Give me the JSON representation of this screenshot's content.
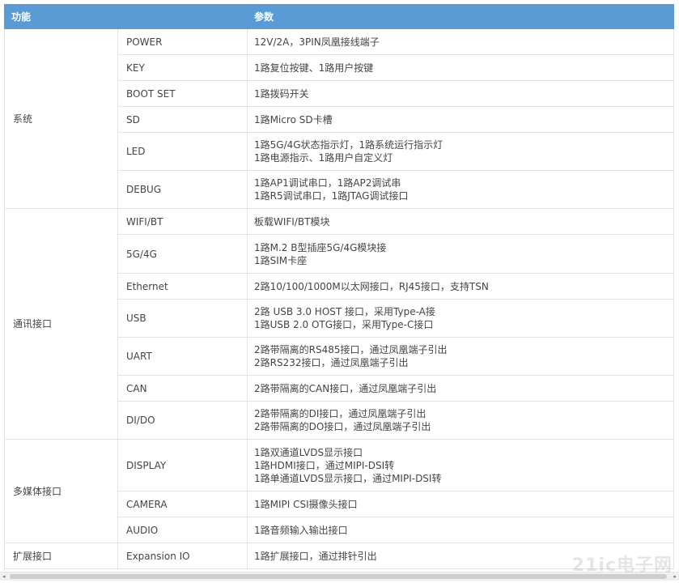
{
  "header": {
    "col_function": "功能",
    "col_params": "参数"
  },
  "groups": [
    {
      "name": "系统",
      "rows": [
        {
          "func": "POWER",
          "lines": [
            "12V/2A，3PIN凤凰接线端子"
          ],
          "h": 32
        },
        {
          "func": "KEY",
          "lines": [
            "1路复位按键、1路用户按键"
          ],
          "h": 32
        },
        {
          "func": "BOOT SET",
          "lines": [
            "1路拨码开关"
          ],
          "h": 32
        },
        {
          "func": "SD",
          "lines": [
            "1路Micro SD卡槽"
          ],
          "h": 32
        },
        {
          "func": "LED",
          "lines": [
            "1路5G/4G状态指示灯，1路系统运行指示灯",
            "1路电源指示、1路用户自定义灯"
          ],
          "h": 47
        },
        {
          "func": "DEBUG",
          "lines": [
            "1路AP1调试串口，1路AP2调试串",
            "1路R5调试串口，1路JTAG调试接口"
          ],
          "h": 47
        }
      ]
    },
    {
      "name": "通讯接口",
      "rows": [
        {
          "func": "WIFI/BT",
          "lines": [
            "板载WIFI/BT模块"
          ],
          "h": 32
        },
        {
          "func": "5G/4G",
          "lines": [
            "1路M.2 B型插座5G/4G模块接",
            "1路SIM卡座"
          ],
          "h": 48
        },
        {
          "func": "Ethernet",
          "lines": [
            "2路10/100/1000M以太网接口，RJ45接口，支持TSN"
          ],
          "h": 32
        },
        {
          "func": "USB",
          "lines": [
            "2路 USB 3.0 HOST 接口，采用Type-A接",
            "1路USB 2.0 OTG接口，采用Type-C接口"
          ],
          "h": 47
        },
        {
          "func": "UART",
          "lines": [
            "2路带隔离的RS485接口，通过凤凰端子引出",
            "2路RS232接口，通过凤凰端子引出"
          ],
          "h": 47
        },
        {
          "func": "CAN",
          "lines": [
            "2路带隔离的CAN接口，通过凤凰端子引出"
          ],
          "h": 32
        },
        {
          "func": "DI/DO",
          "lines": [
            "2路带隔离的DI接口，通过凤凰端子引出",
            "2路带隔离的DO接口，通过凤凰端子引出"
          ],
          "h": 47
        }
      ]
    },
    {
      "name": "多媒体接口",
      "rows": [
        {
          "func": "DISPLAY",
          "lines": [
            "1路双通道LVDS显示接口",
            "1路HDMI接口，通过MIPI-DSI转",
            "1路单通道LVDS显示接口，通过MIPI-DSI转"
          ],
          "h": 64
        },
        {
          "func": "CAMERA",
          "lines": [
            "1路MIPI CSI摄像头接口"
          ],
          "h": 32
        },
        {
          "func": "AUDIO",
          "lines": [
            "1路音频输入输出接口"
          ],
          "h": 32
        }
      ]
    },
    {
      "name": "扩展接口",
      "rows": [
        {
          "func": "Expansion IO",
          "lines": [
            "1路扩展接口，通过排针引出"
          ],
          "h": 32
        }
      ]
    }
  ],
  "scrollbar": {
    "left_arrow": "◂",
    "right_arrow": "▸"
  },
  "watermark": "21ic电子网"
}
